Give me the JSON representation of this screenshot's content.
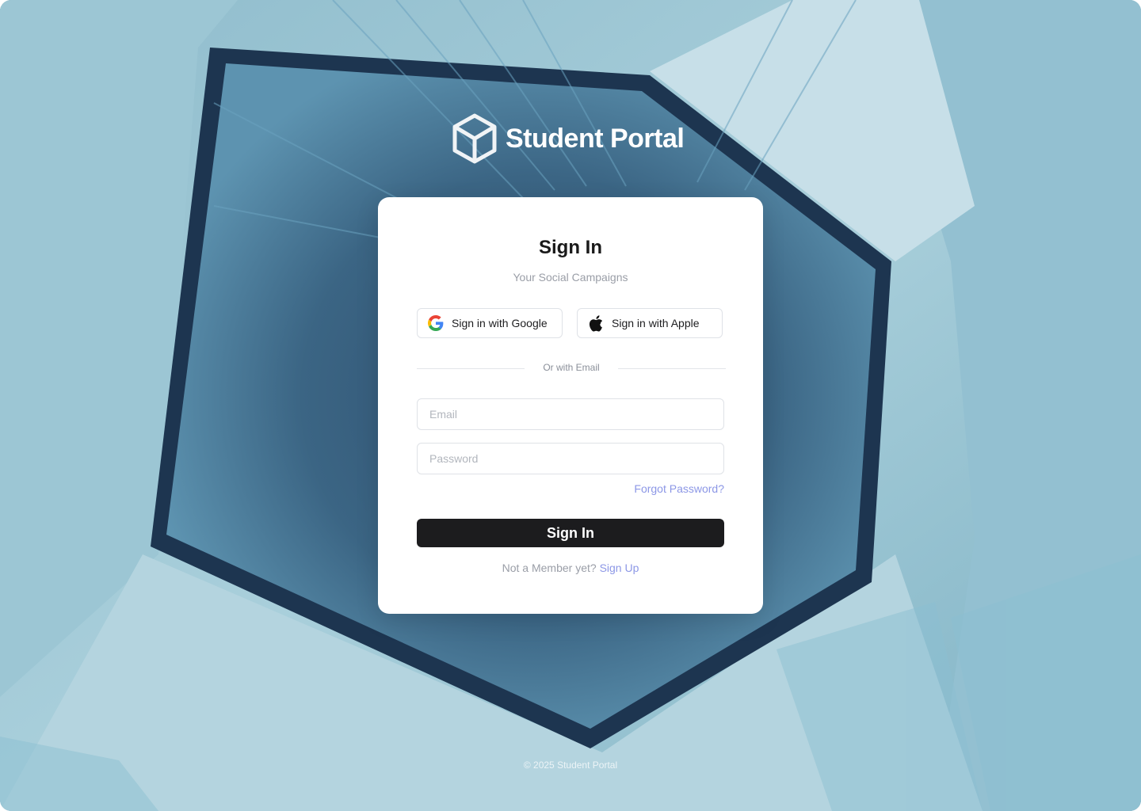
{
  "brand": {
    "name": "Student Portal",
    "logo_icon": "cube-icon"
  },
  "card": {
    "title": "Sign In",
    "subtitle": "Your Social Campaigns",
    "oauth": {
      "google_label": "Sign in with Google",
      "apple_label": "Sign in with Apple"
    },
    "divider_text": "Or with Email",
    "email": {
      "placeholder": "Email",
      "value": ""
    },
    "password": {
      "placeholder": "Password",
      "value": ""
    },
    "forgot_label": "Forgot Password?",
    "submit_label": "Sign In",
    "member_text": "Not a Member yet?",
    "signup_label": "Sign Up"
  },
  "footer": {
    "copyright": "© 2025 Student Portal"
  },
  "colors": {
    "accent_link": "#8c97e6",
    "button_dark": "#1c1c1e",
    "background_tone": "#6ea4b8"
  }
}
